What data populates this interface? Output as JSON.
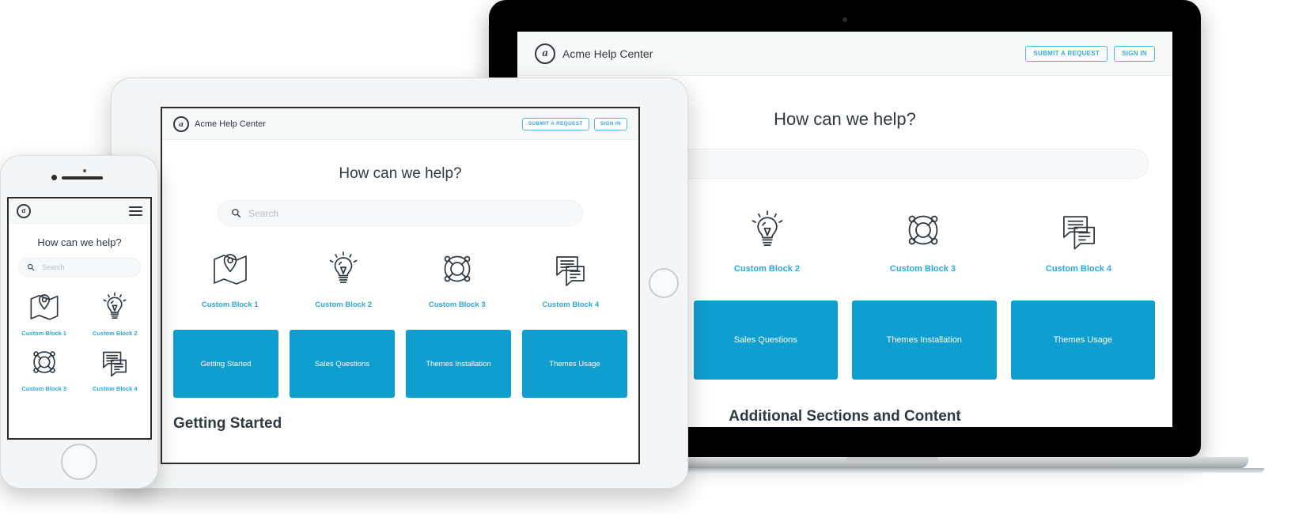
{
  "site": {
    "brand_name": "Acme Help Center",
    "logo_glyph": "a",
    "hero_title": "How can we help?",
    "search_placeholder": "Search",
    "submit_request_label": "SUBMIT A REQUEST",
    "sign_in_label": "SIGN IN",
    "section_title_getting_started": "Getting Started",
    "section_title_additional": "Additional Sections and Content"
  },
  "colors": {
    "accent_blue": "#29a9e1",
    "tile_blue": "#0e9ed0",
    "button_border": "#57b7e2",
    "text_dark": "#2f3941",
    "header_bg": "#f7f8f8",
    "search_bg": "#f7f8f9",
    "placeholder": "#b6bec4"
  },
  "blocks": [
    {
      "label": "Custom Block 1",
      "icon": "map-pin-icon"
    },
    {
      "label": "Custom Block 2",
      "icon": "lightbulb-icon"
    },
    {
      "label": "Custom Block 3",
      "icon": "lifebuoy-icon"
    },
    {
      "label": "Custom Block 4",
      "icon": "chat-bubbles-icon"
    }
  ],
  "tiles": [
    {
      "label": "Getting Started"
    },
    {
      "label": "Sales Questions"
    },
    {
      "label": "Themes Installation"
    },
    {
      "label": "Themes Usage"
    }
  ],
  "devices": {
    "laptop": {
      "name": "laptop-mockup"
    },
    "tablet": {
      "name": "tablet-mockup"
    },
    "phone": {
      "name": "phone-mockup"
    }
  },
  "phone_header": {
    "menu_icon": "hamburger-menu-icon"
  },
  "search_icon": "search-icon"
}
